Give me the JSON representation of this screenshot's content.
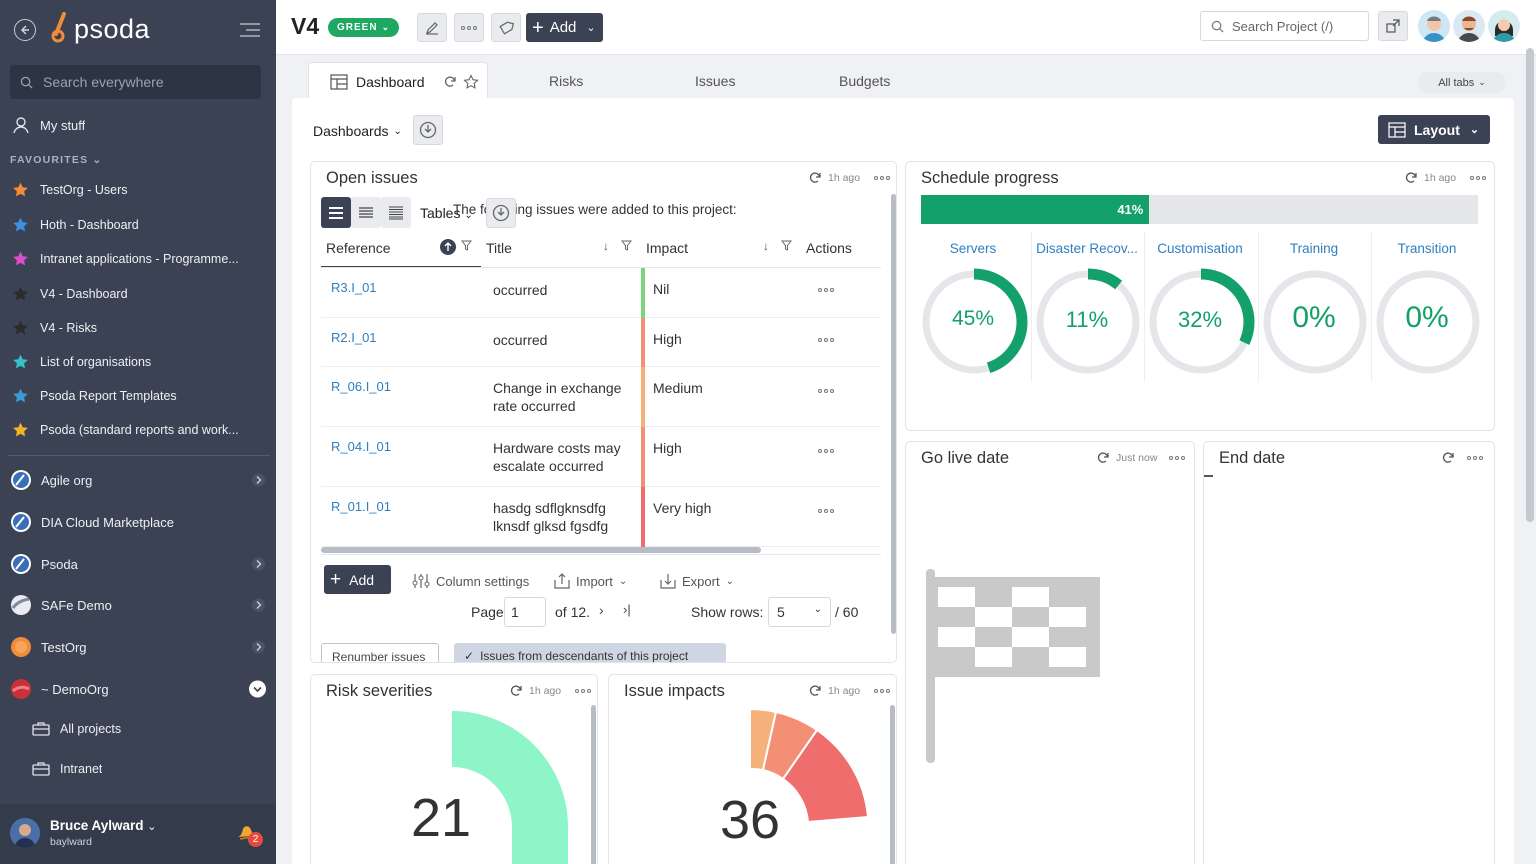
{
  "sidebar": {
    "logo": "psoda",
    "search_placeholder": "Search everywhere",
    "my_stuff": "My stuff",
    "favourites_header": "FAVOURITES",
    "favourites": [
      {
        "label": "TestOrg - Users",
        "color": "#f28c38"
      },
      {
        "label": "Hoth - Dashboard",
        "color": "#3d8fe0"
      },
      {
        "label": "Intranet applications - Programme...",
        "color": "#d94fc9"
      },
      {
        "label": "V4 - Dashboard",
        "color": "#2b2b2b"
      },
      {
        "label": "V4 - Risks",
        "color": "#2b2b2b"
      },
      {
        "label": "List of organisations",
        "color": "#37c1c9"
      },
      {
        "label": "Psoda Report Templates",
        "color": "#3d9ad6"
      },
      {
        "label": "Psoda (standard reports and work...",
        "color": "#f0b429"
      }
    ],
    "orgs": [
      {
        "label": "Agile org"
      },
      {
        "label": "DIA Cloud Marketplace"
      },
      {
        "label": "Psoda"
      },
      {
        "label": "SAFe Demo"
      },
      {
        "label": "TestOrg"
      },
      {
        "label": "~ DemoOrg"
      }
    ],
    "sub_items": [
      {
        "label": "All projects"
      },
      {
        "label": "Intranet"
      }
    ],
    "user_name": "Bruce Aylward",
    "user_login": "baylward",
    "notification_count": "2"
  },
  "header": {
    "title": "V4",
    "status": "GREEN",
    "add_label": "Add",
    "search_placeholder": "Search Project (/)"
  },
  "tabs": {
    "items": [
      "Dashboard",
      "Risks",
      "Issues",
      "Budgets"
    ],
    "all_tabs": "All tabs"
  },
  "toolbar": {
    "dashboards_label": "Dashboards",
    "layout_label": "Layout"
  },
  "open_issues": {
    "title": "Open issues",
    "updated": "1h ago",
    "tables_label": "Tables",
    "intro": "The following issues were added to this project:",
    "columns": [
      "Reference",
      "Title",
      "Impact",
      "Actions"
    ],
    "rows": [
      {
        "ref": "R3.I_01",
        "title": "occurred",
        "impact": "Nil",
        "impact_color": "#7bd67b"
      },
      {
        "ref": "R2.I_01",
        "title": "occurred",
        "impact": "High",
        "impact_color": "#f38f74"
      },
      {
        "ref": "R_06.I_01",
        "title": "Change in exchange rate occurred",
        "impact": "Medium",
        "impact_color": "#f6b07a"
      },
      {
        "ref": "R_04.I_01",
        "title": "Hardware costs may escalate occurred",
        "impact": "High",
        "impact_color": "#f38f74"
      },
      {
        "ref": "R_01.I_01",
        "title": "hasdg sdflgknsdfg lknsdf glksd fgsdfg",
        "impact": "Very high",
        "impact_color": "#ef6d6d"
      }
    ],
    "add_label": "Add",
    "column_settings": "Column settings",
    "import": "Import",
    "export": "Export",
    "page_label": "Page",
    "page_value": "1",
    "of_pages": "of 12.",
    "show_rows_label": "Show rows:",
    "show_rows_value": "5",
    "total": "/ 60",
    "renumber": "Renumber issues",
    "descendants": "Issues from descendants of this project"
  },
  "schedule": {
    "title": "Schedule progress",
    "updated": "1h ago",
    "overall": 41,
    "overall_label": "41%",
    "phases": [
      {
        "name": "Servers",
        "value": 45,
        "label": "45%"
      },
      {
        "name": "Disaster Recov...",
        "value": 11,
        "label": "11%"
      },
      {
        "name": "Customisation",
        "value": 32,
        "label": "32%"
      },
      {
        "name": "Training",
        "value": 0,
        "label": "0%"
      },
      {
        "name": "Transition",
        "value": 0,
        "label": "0%"
      }
    ]
  },
  "go_live": {
    "title": "Go live date",
    "updated": "Just now"
  },
  "end_date": {
    "title": "End date"
  },
  "risk_sev": {
    "title": "Risk severities",
    "updated": "1h ago",
    "value": "21"
  },
  "issue_imp": {
    "title": "Issue impacts",
    "updated": "1h ago",
    "value": "36"
  },
  "colors": {
    "accent": "#13a06a",
    "sidebar": "#3a4253",
    "link": "#2f7fc1"
  }
}
